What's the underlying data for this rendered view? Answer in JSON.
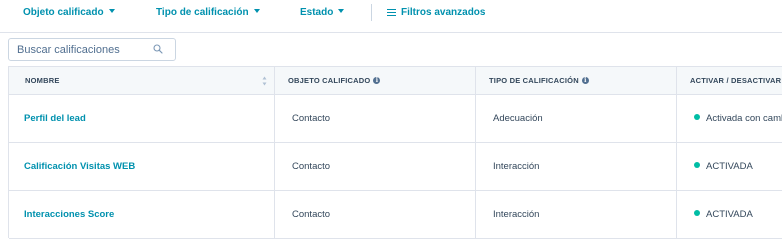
{
  "filters": {
    "objeto": "Objeto calificado",
    "tipo": "Tipo de calificación",
    "estado": "Estado",
    "avanzados": "Filtros avanzados"
  },
  "search": {
    "placeholder": "Buscar calificaciones"
  },
  "table": {
    "headers": {
      "nombre": "NOMBRE",
      "objeto": "OBJETO CALIFICADO",
      "tipo": "TIPO DE CALIFICACIÓN",
      "activar": "ACTIVAR / DESACTIVAR"
    },
    "rows": [
      {
        "nombre": "Perfil del lead",
        "objeto": "Contacto",
        "tipo": "Adecuación",
        "estado": "Activada con cambios"
      },
      {
        "nombre": "Calificación Visitas WEB",
        "objeto": "Contacto",
        "tipo": "Interacción",
        "estado": "ACTIVADA"
      },
      {
        "nombre": "Interacciones Score",
        "objeto": "Contacto",
        "tipo": "Interacción",
        "estado": "ACTIVADA"
      }
    ]
  },
  "colors": {
    "link": "#0091ae",
    "status_active": "#00bda5",
    "header_bg": "#f5f8fa",
    "border": "#dfe3eb",
    "text": "#33475b"
  }
}
